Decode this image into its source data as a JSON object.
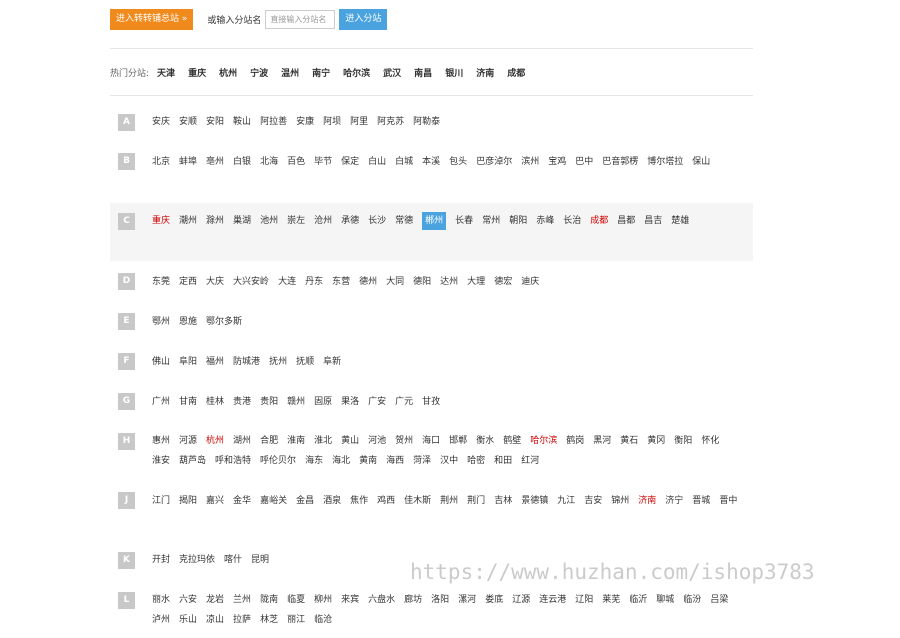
{
  "top": {
    "main_button": "进入转转铺总站 »",
    "or_label": "或输入分站名",
    "search_placeholder": "直接输入分站名",
    "go_button": "进入分站"
  },
  "hot": {
    "label": "热门分站:",
    "cities": [
      "天津",
      "重庆",
      "杭州",
      "宁波",
      "温州",
      "南宁",
      "哈尔滨",
      "武汉",
      "南昌",
      "银川",
      "济南",
      "成都"
    ]
  },
  "rows": [
    {
      "letter": "A",
      "cities": [
        {
          "n": "安庆"
        },
        {
          "n": "安顺"
        },
        {
          "n": "安阳"
        },
        {
          "n": "鞍山"
        },
        {
          "n": "阿拉善"
        },
        {
          "n": "安康"
        },
        {
          "n": "阿坝"
        },
        {
          "n": "阿里"
        },
        {
          "n": "阿克苏"
        },
        {
          "n": "阿勒泰"
        }
      ]
    },
    {
      "letter": "B",
      "cities": [
        {
          "n": "北京"
        },
        {
          "n": "蚌埠"
        },
        {
          "n": "亳州"
        },
        {
          "n": "白银"
        },
        {
          "n": "北海"
        },
        {
          "n": "百色"
        },
        {
          "n": "毕节"
        },
        {
          "n": "保定"
        },
        {
          "n": "白山"
        },
        {
          "n": "白城"
        },
        {
          "n": "本溪"
        },
        {
          "n": "包头"
        },
        {
          "n": "巴彦淖尔"
        },
        {
          "n": "滨州"
        },
        {
          "n": "宝鸡"
        },
        {
          "n": "巴中"
        },
        {
          "n": "巴音郭楞"
        },
        {
          "n": "博尔塔拉"
        },
        {
          "n": "保山"
        }
      ]
    },
    {
      "letter": "C",
      "hl": true,
      "cities": [
        {
          "n": "重庆",
          "s": "red"
        },
        {
          "n": "潮州"
        },
        {
          "n": "滁州"
        },
        {
          "n": "巢湖"
        },
        {
          "n": "池州"
        },
        {
          "n": "崇左"
        },
        {
          "n": "沧州"
        },
        {
          "n": "承德"
        },
        {
          "n": "长沙"
        },
        {
          "n": "常德"
        },
        {
          "n": "郴州",
          "s": "sel"
        },
        {
          "n": "长春"
        },
        {
          "n": "常州"
        },
        {
          "n": "朝阳"
        },
        {
          "n": "赤峰"
        },
        {
          "n": "长治"
        },
        {
          "n": "成都",
          "s": "red"
        },
        {
          "n": "昌都"
        },
        {
          "n": "昌吉"
        },
        {
          "n": "楚雄"
        }
      ]
    },
    {
      "letter": "D",
      "cities": [
        {
          "n": "东莞"
        },
        {
          "n": "定西"
        },
        {
          "n": "大庆"
        },
        {
          "n": "大兴安岭"
        },
        {
          "n": "大连"
        },
        {
          "n": "丹东"
        },
        {
          "n": "东营"
        },
        {
          "n": "德州"
        },
        {
          "n": "大同"
        },
        {
          "n": "德阳"
        },
        {
          "n": "达州"
        },
        {
          "n": "大理"
        },
        {
          "n": "德宏"
        },
        {
          "n": "迪庆"
        }
      ]
    },
    {
      "letter": "E",
      "cities": [
        {
          "n": "鄂州"
        },
        {
          "n": "恩施"
        },
        {
          "n": "鄂尔多斯"
        }
      ]
    },
    {
      "letter": "F",
      "cities": [
        {
          "n": "佛山"
        },
        {
          "n": "阜阳"
        },
        {
          "n": "福州"
        },
        {
          "n": "防城港"
        },
        {
          "n": "抚州"
        },
        {
          "n": "抚顺"
        },
        {
          "n": "阜新"
        }
      ]
    },
    {
      "letter": "G",
      "cities": [
        {
          "n": "广州"
        },
        {
          "n": "甘南"
        },
        {
          "n": "桂林"
        },
        {
          "n": "贵港"
        },
        {
          "n": "贵阳"
        },
        {
          "n": "赣州"
        },
        {
          "n": "固原"
        },
        {
          "n": "果洛"
        },
        {
          "n": "广安"
        },
        {
          "n": "广元"
        },
        {
          "n": "甘孜"
        }
      ]
    },
    {
      "letter": "H",
      "cities": [
        {
          "n": "惠州"
        },
        {
          "n": "河源"
        },
        {
          "n": "杭州",
          "s": "red"
        },
        {
          "n": "湖州"
        },
        {
          "n": "合肥"
        },
        {
          "n": "淮南"
        },
        {
          "n": "淮北"
        },
        {
          "n": "黄山"
        },
        {
          "n": "河池"
        },
        {
          "n": "贺州"
        },
        {
          "n": "海口"
        },
        {
          "n": "邯郸"
        },
        {
          "n": "衡水"
        },
        {
          "n": "鹤壁"
        },
        {
          "n": "哈尔滨",
          "s": "red"
        },
        {
          "n": "鹤岗"
        },
        {
          "n": "黑河"
        },
        {
          "n": "黄石"
        },
        {
          "n": "黄冈"
        },
        {
          "n": "衡阳"
        },
        {
          "n": "怀化"
        },
        {
          "n": "淮安"
        },
        {
          "n": "葫芦岛"
        },
        {
          "n": "呼和浩特"
        },
        {
          "n": "呼伦贝尔"
        },
        {
          "n": "海东"
        },
        {
          "n": "海北"
        },
        {
          "n": "黄南"
        },
        {
          "n": "海西"
        },
        {
          "n": "菏泽"
        },
        {
          "n": "汉中"
        },
        {
          "n": "哈密"
        },
        {
          "n": "和田"
        },
        {
          "n": "红河"
        }
      ]
    },
    {
      "letter": "J",
      "cities": [
        {
          "n": "江门"
        },
        {
          "n": "揭阳"
        },
        {
          "n": "嘉兴"
        },
        {
          "n": "金华"
        },
        {
          "n": "嘉峪关"
        },
        {
          "n": "金昌"
        },
        {
          "n": "酒泉"
        },
        {
          "n": "焦作"
        },
        {
          "n": "鸡西"
        },
        {
          "n": "佳木斯"
        },
        {
          "n": "荆州"
        },
        {
          "n": "荆门"
        },
        {
          "n": "吉林"
        },
        {
          "n": "景德镇"
        },
        {
          "n": "九江"
        },
        {
          "n": "吉安"
        },
        {
          "n": "锦州"
        },
        {
          "n": "济南",
          "s": "red"
        },
        {
          "n": "济宁"
        },
        {
          "n": "晋城"
        },
        {
          "n": "晋中"
        }
      ]
    },
    {
      "letter": "K",
      "cities": [
        {
          "n": "开封"
        },
        {
          "n": "克拉玛依"
        },
        {
          "n": "喀什"
        },
        {
          "n": "昆明"
        }
      ]
    },
    {
      "letter": "L",
      "cities": [
        {
          "n": "丽水"
        },
        {
          "n": "六安"
        },
        {
          "n": "龙岩"
        },
        {
          "n": "兰州"
        },
        {
          "n": "陇南"
        },
        {
          "n": "临夏"
        },
        {
          "n": "柳州"
        },
        {
          "n": "来宾"
        },
        {
          "n": "六盘水"
        },
        {
          "n": "廊坊"
        },
        {
          "n": "洛阳"
        },
        {
          "n": "漯河"
        },
        {
          "n": "娄底"
        },
        {
          "n": "辽源"
        },
        {
          "n": "连云港"
        },
        {
          "n": "辽阳"
        },
        {
          "n": "莱芜"
        },
        {
          "n": "临沂"
        },
        {
          "n": "聊城"
        },
        {
          "n": "临汾"
        },
        {
          "n": "吕梁"
        },
        {
          "n": "泸州"
        },
        {
          "n": "乐山"
        },
        {
          "n": "凉山"
        },
        {
          "n": "拉萨"
        },
        {
          "n": "林芝"
        },
        {
          "n": "丽江"
        },
        {
          "n": "临沧"
        }
      ]
    }
  ],
  "watermark": "https://www.huzhan.com/ishop3783"
}
